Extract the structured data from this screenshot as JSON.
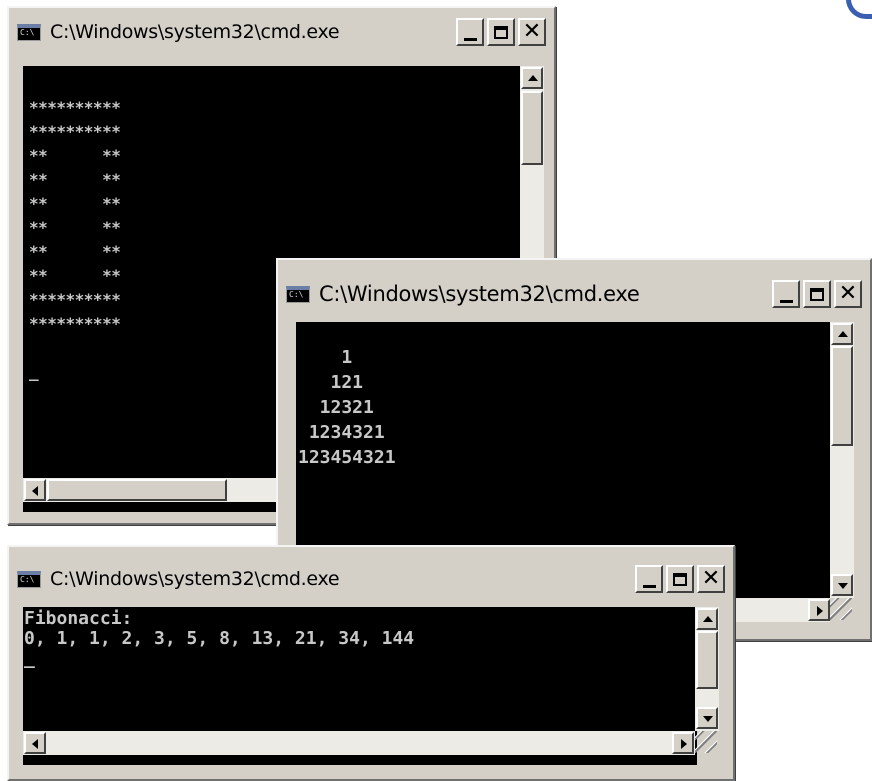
{
  "windows": {
    "w1": {
      "title": "C:\\Windows\\system32\\cmd.exe",
      "icon_text": "C:\\",
      "output": "\n**********\n**********\n**      **\n**      **\n**      **\n**      **\n**      **\n**      **\n**********\n**********\n\n_"
    },
    "w2": {
      "title": "C:\\Windows\\system32\\cmd.exe",
      "icon_text": "C:\\",
      "output": "\n    1\n   121\n  12321\n 1234321\n123454321"
    },
    "w3": {
      "title": "C:\\Windows\\system32\\cmd.exe",
      "icon_text": "C:\\",
      "output": "Fibonacci:\n0, 1, 1, 2, 3, 5, 8, 13, 21, 34, 144\n_"
    }
  },
  "icons": {
    "minimize": "minimize-icon",
    "maximize": "maximize-icon",
    "close": "close-icon",
    "app": "cmd-app-icon"
  },
  "colors": {
    "console_bg": "#000000",
    "console_text": "#c8c8c8",
    "chrome": "#d4d0c8",
    "corner_accent": "#3a5fb0"
  }
}
